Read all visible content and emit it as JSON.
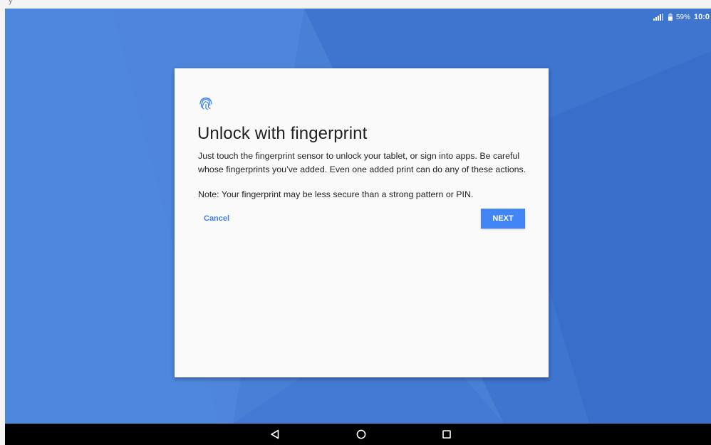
{
  "top_strip": {
    "fragment_text": "y"
  },
  "status_bar": {
    "signal_icon": "cellular-signal-icon",
    "battery_icon": "battery-icon",
    "battery_percent": "59%",
    "time": "10:0"
  },
  "dialog": {
    "icon": "fingerprint-icon",
    "title": "Unlock with fingerprint",
    "body": "Just touch the fingerprint sensor to unlock your tablet, or sign into apps. Be careful whose fingerprints you’ve added. Even one added print can do any of these actions.",
    "note": "Note: Your fingerprint may be less secure than a strong pattern or PIN.",
    "cancel_label": "Cancel",
    "next_label": "NEXT"
  },
  "nav_bar": {
    "back_icon": "back-triangle-icon",
    "home_icon": "home-circle-icon",
    "recents_icon": "recents-square-icon"
  },
  "colors": {
    "accent": "#4285f4",
    "wallpaper": "#4a7fd6",
    "dialog_background": "#fafafa"
  }
}
